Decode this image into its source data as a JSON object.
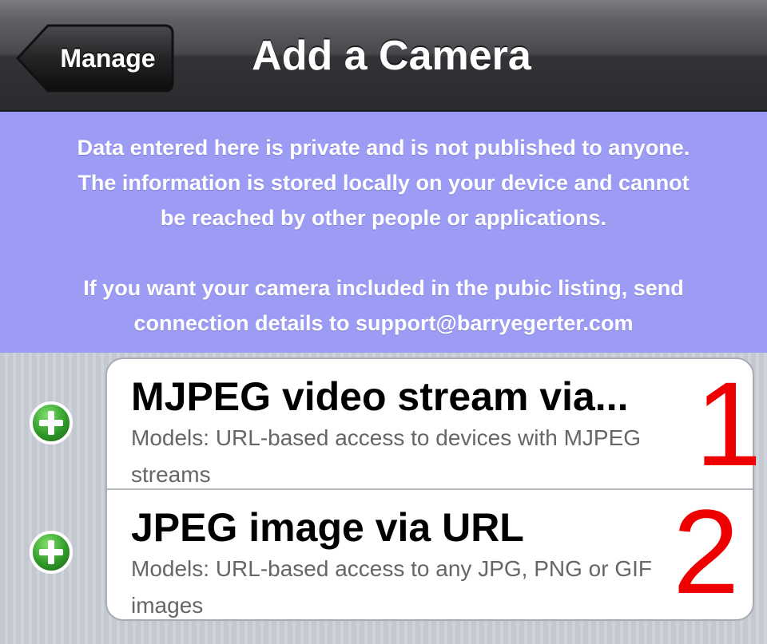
{
  "navbar": {
    "back_label": "Manage",
    "title": "Add a Camera"
  },
  "info": {
    "line1": "Data entered here is private and is not published to anyone.",
    "line2": "The information is stored locally on your device and cannot",
    "line3": "be reached by other people or applications.",
    "line4": "If you want your camera included in the pubic listing, send",
    "line5": "connection details to support@barryegerter.com"
  },
  "rows": [
    {
      "title": "MJPEG video stream via...",
      "subtitle": "Models: URL-based access to devices with MJPEG streams",
      "annotation": "1"
    },
    {
      "title": "JPEG image via URL",
      "subtitle": "Models: URL-based access to any JPG, PNG or GIF images",
      "annotation": "2"
    }
  ],
  "colors": {
    "banner": "#9c9cf4",
    "add_green": "#2f9a28",
    "annotation_red": "#ee0000"
  },
  "icons": {
    "row_add": "add-icon"
  }
}
